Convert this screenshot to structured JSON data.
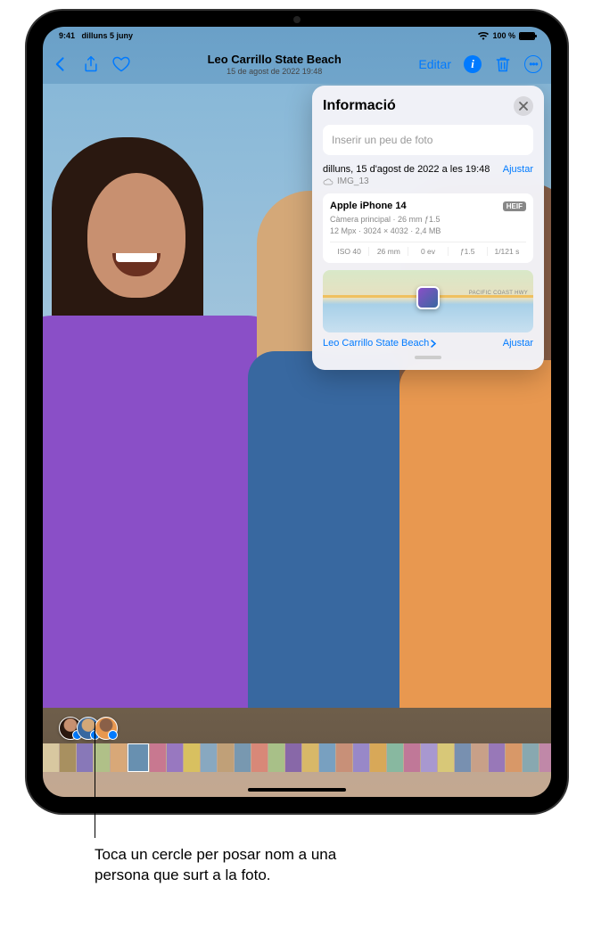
{
  "statusbar": {
    "time": "9:41",
    "date": "dilluns 5 juny",
    "battery_pct": "100 %"
  },
  "navbar": {
    "title": "Leo Carrillo State Beach",
    "subtitle": "15 de agost de 2022  19:48",
    "edit_label": "Editar"
  },
  "info_panel": {
    "title": "Informació",
    "caption_placeholder": "Inserir un peu de foto",
    "date_line": "dilluns, 15 d'agost de 2022 a les 19:48",
    "adjust_label": "Ajustar",
    "file_name": "IMG_13",
    "camera_model": "Apple iPhone 14",
    "format_badge": "HEIF",
    "lens_line": "Càmera principal · 26 mm ƒ1.5",
    "resolution_line": "12 Mpx · 3024 × 4032 · 2,4 MB",
    "exif": {
      "iso": "ISO 40",
      "focal": "26 mm",
      "ev": "0 ev",
      "aperture": "ƒ1.5",
      "shutter": "1/121 s"
    },
    "location_name": "Leo Carrillo State Beach",
    "map_label": "PACIFIC COAST HWY",
    "adjust_location_label": "Ajustar"
  },
  "thumbnails": {
    "colors": [
      "#d8c8a0",
      "#a89060",
      "#8878b8",
      "#b0c088",
      "#d8a878",
      "#6890b0",
      "#c87890",
      "#9878c0",
      "#d8c060",
      "#88a8c0",
      "#c0a078",
      "#7898b0",
      "#d88878",
      "#a8c088",
      "#8868a8",
      "#d8b868",
      "#78a0c0",
      "#c89078",
      "#9888c8",
      "#d8a858",
      "#88b8a0",
      "#c07898",
      "#a898d0",
      "#d8c878",
      "#7890b0",
      "#c8a088",
      "#9878b8",
      "#d89868",
      "#88a8b0",
      "#c088a8"
    ],
    "active_index": 5
  },
  "callout": {
    "text": "Toca un cercle per posar nom a una persona que surt a la foto."
  }
}
